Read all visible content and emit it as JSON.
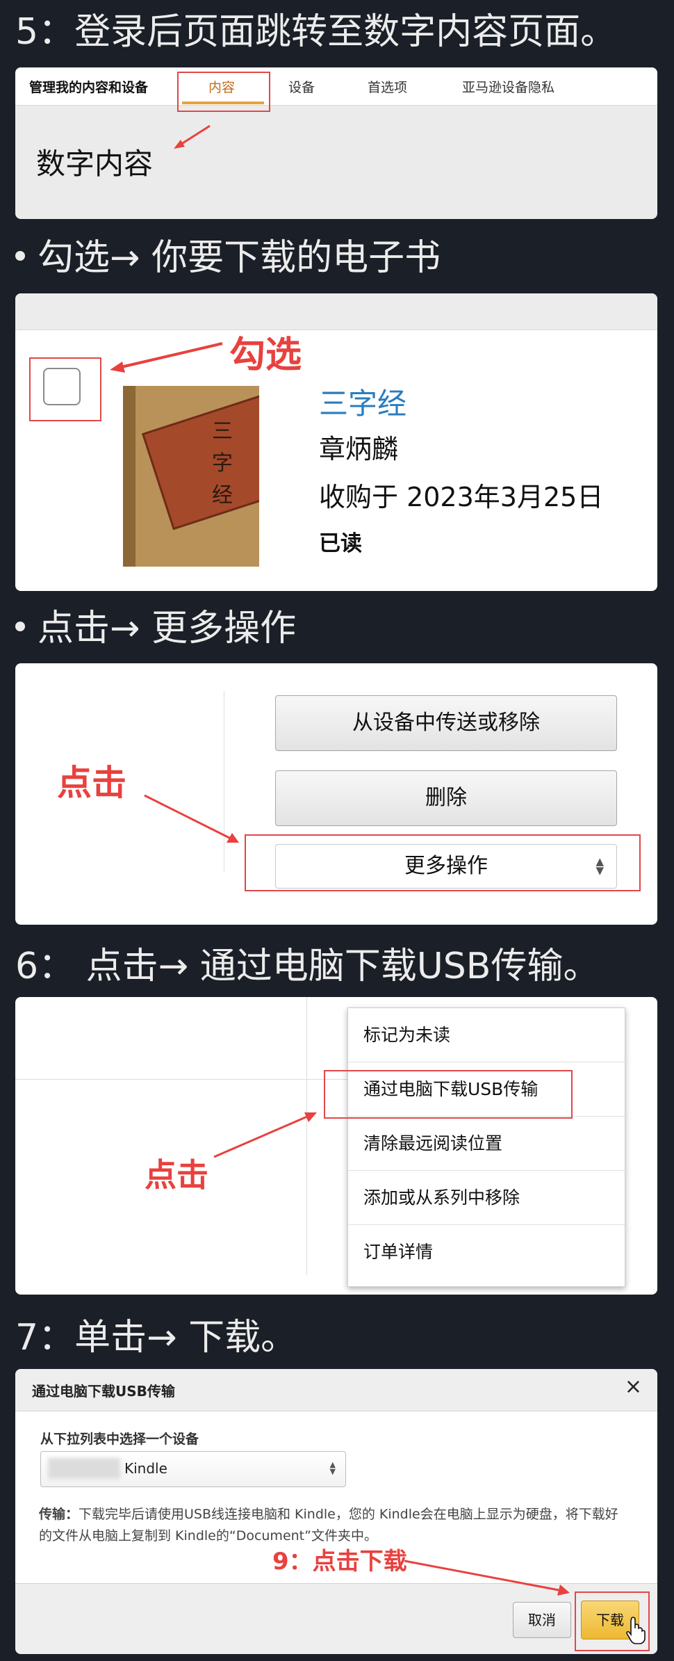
{
  "step5": {
    "heading": "5：登录后页面跳转至数字内容页面。",
    "nav": {
      "title": "管理我的内容和设备",
      "tab_content": "内容",
      "tab_devices": "设备",
      "tab_preferences": "首选项",
      "tab_privacy": "亚马逊设备隐私"
    },
    "page_title": "数字内容"
  },
  "step_check": {
    "heading": "勾选→ 你要下载的电子书",
    "annotation": "勾选",
    "book": {
      "cover_chars": [
        "三",
        "字",
        "经"
      ],
      "title": "三字经",
      "author": "章炳麟",
      "purchase_date": "收购于 2023年3月25日",
      "status": "已读"
    }
  },
  "step_more": {
    "heading": "点击→ 更多操作",
    "annotation": "点击",
    "buttons": {
      "send_remove": "从设备中传送或移除",
      "delete": "删除",
      "more_actions": "更多操作"
    }
  },
  "step6": {
    "heading": "6： 点击→ 通过电脑下载USB传输。",
    "annotation": "点击",
    "menu_items": [
      "标记为未读",
      "通过电脑下载USB传输",
      "清除最远阅读位置",
      "添加或从系列中移除",
      "订单详情"
    ]
  },
  "step7": {
    "heading": "7：单击→ 下载。",
    "dialog": {
      "title": "通过电脑下载USB传输",
      "close": "×",
      "select_label": "从下拉列表中选择一个设备",
      "selected_device": "Kindle",
      "transfer_label": "传输：",
      "transfer_text": "下载完毕后请使用USB线连接电脑和 Kindle，您的 Kindle会在电脑上显示为硬盘，将下载好的文件从电脑上复制到 Kindle的“Document”文件夹中。",
      "cancel": "取消",
      "download": "下载"
    },
    "annotation": "9：点击下载"
  },
  "colors": {
    "background": "#1b1f27",
    "annotation_red": "#e8413e",
    "link_blue": "#2a7dbf",
    "tab_underline": "#e8a33c",
    "download_button": "#f3c54b"
  }
}
